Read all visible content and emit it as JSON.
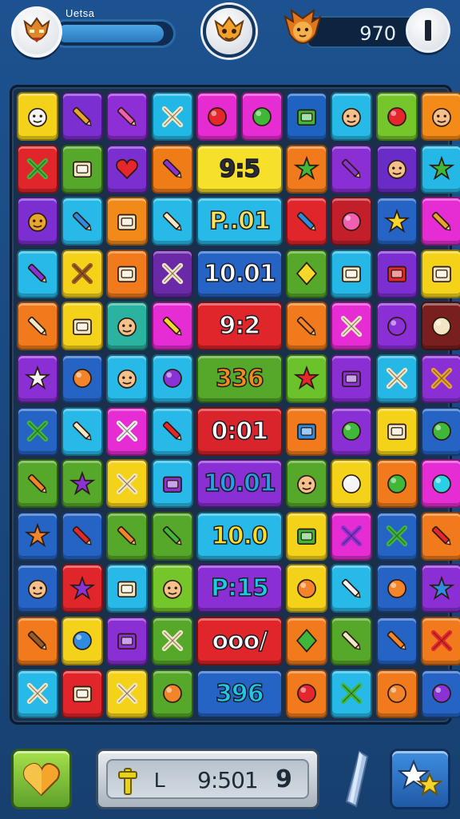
{
  "header": {
    "player_name": "Uetsa",
    "progress": 0.93,
    "score": "970",
    "left_avatar_icon": "tribal-mask-icon",
    "center_badge_icon": "golden-mask-icon",
    "right_avatar_icon": "lion-mask-icon",
    "pause_icon": "pause-icon"
  },
  "board": {
    "cells": [
      {
        "kind": "tile",
        "color": "#f5d21a",
        "icon": "white-mask-icon"
      },
      {
        "kind": "tile",
        "color": "#7b2fd0",
        "icon": "golden-scepter-icon"
      },
      {
        "kind": "tile",
        "color": "#8e2ed6",
        "icon": "pink-crayon-icon"
      },
      {
        "kind": "tile",
        "color": "#22b8e6",
        "icon": "palm-tree-icon"
      },
      {
        "kind": "tile",
        "color": "#e62bd1",
        "icon": "red-fish-icon"
      },
      {
        "kind": "tile",
        "color": "#e52dd3",
        "icon": "green-leaf-icon"
      },
      {
        "kind": "tile",
        "color": "#1f63c2",
        "icon": "green-bucket-icon"
      },
      {
        "kind": "tile",
        "color": "#27b9e8",
        "icon": "red-hat-face-icon"
      },
      {
        "kind": "tile",
        "color": "#74c62a",
        "icon": "red-apple-icon"
      },
      {
        "kind": "tile",
        "color": "#f48a18",
        "icon": "boy-face-icon"
      },
      {
        "kind": "tile",
        "color": "#e0262a",
        "icon": "green-dragon-icon"
      },
      {
        "kind": "tile",
        "color": "#55a829",
        "icon": "calculator-icon"
      },
      {
        "kind": "tile",
        "color": "#7b2fd0",
        "icon": "heart-icon"
      },
      {
        "kind": "tile",
        "color": "#f07c18",
        "icon": "purple-pen-icon"
      },
      {
        "kind": "wide",
        "color": "#f7e02a",
        "text_color": "#2b2b36",
        "text": "9:5"
      },
      {
        "kind": "tile",
        "color": "#f07a1c",
        "icon": "green-star-icon"
      },
      {
        "kind": "tile",
        "color": "#8a2fd4",
        "icon": "purple-marker-icon"
      },
      {
        "kind": "tile",
        "color": "#6a2cc6",
        "icon": "arrowhead-icon"
      },
      {
        "kind": "tile",
        "color": "#25b7e6",
        "icon": "green-starfish-icon"
      },
      {
        "kind": "tile",
        "color": "#7b2fd0",
        "icon": "lion-face-icon"
      },
      {
        "kind": "tile",
        "color": "#27b9e8",
        "icon": "blue-crayon-icon"
      },
      {
        "kind": "tile",
        "color": "#f28a1a",
        "icon": "lantern-icon"
      },
      {
        "kind": "tile",
        "color": "#27b9e8",
        "icon": "slash-stick-icon"
      },
      {
        "kind": "wide",
        "color": "#27b9e8",
        "text_color": "#f7e45a",
        "text": "P..01"
      },
      {
        "kind": "tile",
        "color": "#e0262a",
        "icon": "blue-pencil-icon"
      },
      {
        "kind": "tile",
        "color": "#c21f2a",
        "icon": "pink-blob-icon"
      },
      {
        "kind": "tile",
        "color": "#2563c4",
        "icon": "yellow-star-icon"
      },
      {
        "kind": "tile",
        "color": "#e52dd3",
        "icon": "golden-sword-icon"
      },
      {
        "kind": "tile",
        "color": "#27b9e8",
        "icon": "purple-crayon-icon"
      },
      {
        "kind": "tile",
        "color": "#f5d21a",
        "icon": "wooden-cross-icon"
      },
      {
        "kind": "tile",
        "color": "#f07a1c",
        "icon": "camera-box-icon"
      },
      {
        "kind": "tile",
        "color": "#6a2aa8",
        "icon": "letter-t-icon"
      },
      {
        "kind": "wide",
        "color": "#2563c4",
        "text_color": "#ffffff",
        "text": "10.01"
      },
      {
        "kind": "tile",
        "color": "#55a829",
        "icon": "yellow-gem-icon"
      },
      {
        "kind": "tile",
        "color": "#25b7e6",
        "icon": "monitor-icon"
      },
      {
        "kind": "tile",
        "color": "#7b2fd0",
        "icon": "red-case-icon"
      },
      {
        "kind": "tile",
        "color": "#f5d21a",
        "icon": "camera-icon"
      },
      {
        "kind": "tile",
        "color": "#f07a1c",
        "icon": "bow-arrow-icon"
      },
      {
        "kind": "tile",
        "color": "#f5d21a",
        "icon": "treasure-box-icon"
      },
      {
        "kind": "tile",
        "color": "#2ab3a0",
        "icon": "face-icon"
      },
      {
        "kind": "tile",
        "color": "#e52dd3",
        "icon": "yellow-pencil-icon"
      },
      {
        "kind": "wide",
        "color": "#e0262a",
        "text_color": "#ffffff",
        "text": "9:2"
      },
      {
        "kind": "tile",
        "color": "#f07a1c",
        "icon": "orange-stick-icon"
      },
      {
        "kind": "tile",
        "color": "#e52dd3",
        "icon": "axe-icon"
      },
      {
        "kind": "tile",
        "color": "#8a2fd4",
        "icon": "purple-swirl-icon"
      },
      {
        "kind": "tile",
        "color": "#7a1f1f",
        "icon": "round-shield-icon"
      },
      {
        "kind": "tile",
        "color": "#8a2fd4",
        "icon": "white-star-icon"
      },
      {
        "kind": "tile",
        "color": "#2563c4",
        "icon": "orange-bird-icon"
      },
      {
        "kind": "tile",
        "color": "#27b9e8",
        "icon": "kid-face-icon"
      },
      {
        "kind": "tile",
        "color": "#27b9e8",
        "icon": "purple-cloud-icon"
      },
      {
        "kind": "wide",
        "color": "#55a829",
        "text_color": "#f58a1a",
        "text": "336"
      },
      {
        "kind": "tile",
        "color": "#6cc22a",
        "icon": "red-flower-icon"
      },
      {
        "kind": "tile",
        "color": "#8a2fd4",
        "icon": "purple-vase-icon"
      },
      {
        "kind": "tile",
        "color": "#25b7e6",
        "icon": "map-scroll-icon"
      },
      {
        "kind": "tile",
        "color": "#8a2fd4",
        "icon": "golden-feather-icon"
      },
      {
        "kind": "tile",
        "color": "#2563c4",
        "icon": "green-bottle-icon"
      },
      {
        "kind": "tile",
        "color": "#27b9e8",
        "icon": "brush-icon"
      },
      {
        "kind": "tile",
        "color": "#e52dd3",
        "icon": "white-lamp-icon"
      },
      {
        "kind": "tile",
        "color": "#27b9e8",
        "icon": "red-marker-icon"
      },
      {
        "kind": "wide",
        "color": "#d8242a",
        "text_color": "#ffffff",
        "text": "0:01"
      },
      {
        "kind": "tile",
        "color": "#f07a1c",
        "icon": "blue-tag-icon"
      },
      {
        "kind": "tile",
        "color": "#8a2fd4",
        "icon": "green-zero-icon"
      },
      {
        "kind": "tile",
        "color": "#f5d21a",
        "icon": "lantern-sign-icon"
      },
      {
        "kind": "tile",
        "color": "#2563c4",
        "icon": "green-nine-icon"
      },
      {
        "kind": "tile",
        "color": "#55a829",
        "icon": "orange-carrot-icon"
      },
      {
        "kind": "tile",
        "color": "#55a829",
        "icon": "purple-flower-icon"
      },
      {
        "kind": "tile",
        "color": "#f5d21a",
        "icon": "bread-icon"
      },
      {
        "kind": "tile",
        "color": "#27b9e8",
        "icon": "purple-bag-icon"
      },
      {
        "kind": "wide",
        "color": "#8a2fd4",
        "text_color": "#2b9ce6",
        "text": "10.01"
      },
      {
        "kind": "tile",
        "color": "#55a829",
        "icon": "purple-mask-icon"
      },
      {
        "kind": "tile",
        "color": "#f5d21a",
        "icon": "white-shell-icon"
      },
      {
        "kind": "tile",
        "color": "#f07a1c",
        "icon": "green-nine-icon"
      },
      {
        "kind": "tile",
        "color": "#e52dd3",
        "icon": "cyan-bomb-icon"
      },
      {
        "kind": "tile",
        "color": "#2563c4",
        "icon": "orange-maple-icon"
      },
      {
        "kind": "tile",
        "color": "#2563c4",
        "icon": "red-pencil-icon"
      },
      {
        "kind": "tile",
        "color": "#55a829",
        "icon": "orange-crayon-icon"
      },
      {
        "kind": "tile",
        "color": "#55a829",
        "icon": "green-syringe-icon"
      },
      {
        "kind": "wide",
        "color": "#27b9e8",
        "text_color": "#f7e02a",
        "text": "10.0"
      },
      {
        "kind": "tile",
        "color": "#f5d21a",
        "icon": "green-box-icon"
      },
      {
        "kind": "tile",
        "color": "#e52dd3",
        "icon": "purple-spray-icon"
      },
      {
        "kind": "tile",
        "color": "#2563c4",
        "icon": "green-hammer-icon"
      },
      {
        "kind": "tile",
        "color": "#f07a1c",
        "icon": "red-rocket-icon"
      },
      {
        "kind": "tile",
        "color": "#2563c4",
        "icon": "pirate-face-icon"
      },
      {
        "kind": "tile",
        "color": "#e0262a",
        "icon": "purple-star-icon"
      },
      {
        "kind": "tile",
        "color": "#27b9e8",
        "icon": "note-paper-icon"
      },
      {
        "kind": "tile",
        "color": "#74c62a",
        "icon": "man-face-icon"
      },
      {
        "kind": "wide",
        "color": "#8a2fd4",
        "text_color": "#1ec8e6",
        "text": "P:15"
      },
      {
        "kind": "tile",
        "color": "#f5d21a",
        "icon": "orange-swirl-icon"
      },
      {
        "kind": "tile",
        "color": "#27b9e8",
        "icon": "white-marker-icon"
      },
      {
        "kind": "tile",
        "color": "#2563c4",
        "icon": "orange-ball-icon"
      },
      {
        "kind": "tile",
        "color": "#8a2fd4",
        "icon": "blue-gear-icon"
      },
      {
        "kind": "tile",
        "color": "#f07a1c",
        "icon": "wooden-sword-icon"
      },
      {
        "kind": "tile",
        "color": "#f5d21a",
        "icon": "blue-shield-icon"
      },
      {
        "kind": "tile",
        "color": "#8a2fd4",
        "icon": "purple-screen-icon"
      },
      {
        "kind": "tile",
        "color": "#55a829",
        "icon": "magnifier-icon"
      },
      {
        "kind": "wide",
        "color": "#e0262a",
        "text_color": "#ffffff",
        "text": "ooo/"
      },
      {
        "kind": "tile",
        "color": "#f07a1c",
        "icon": "green-diamond-icon"
      },
      {
        "kind": "tile",
        "color": "#55a829",
        "icon": "rifle-icon"
      },
      {
        "kind": "tile",
        "color": "#2563c4",
        "icon": "orange-baton-icon"
      },
      {
        "kind": "tile",
        "color": "#f07a1c",
        "icon": "red-x-icon"
      },
      {
        "kind": "tile",
        "color": "#27b9e8",
        "icon": "palm-tree-icon"
      },
      {
        "kind": "tile",
        "color": "#e0262a",
        "icon": "camera-icon"
      },
      {
        "kind": "tile",
        "color": "#f5d21a",
        "icon": "feather-icon"
      },
      {
        "kind": "tile",
        "color": "#55a829",
        "icon": "orange-knot-icon"
      },
      {
        "kind": "wide",
        "color": "#2563c4",
        "text_color": "#1ec8e6",
        "text": "396"
      },
      {
        "kind": "tile",
        "color": "#f07a1c",
        "icon": "red-nine-icon"
      },
      {
        "kind": "tile",
        "color": "#27b9e8",
        "icon": "green-x-icon"
      },
      {
        "kind": "tile",
        "color": "#f07a1c",
        "icon": "orange-cookie-icon"
      },
      {
        "kind": "tile",
        "color": "#2563c4",
        "icon": "purple-orb-icon"
      }
    ]
  },
  "footer": {
    "heart_button_icon": "heart-icon",
    "status_label": "L",
    "status_time": "9:501",
    "status_number": "9",
    "key_icon": "key-icon",
    "crystal_icon": "crystal-icon",
    "stars_button_icon": "stars-icon"
  }
}
